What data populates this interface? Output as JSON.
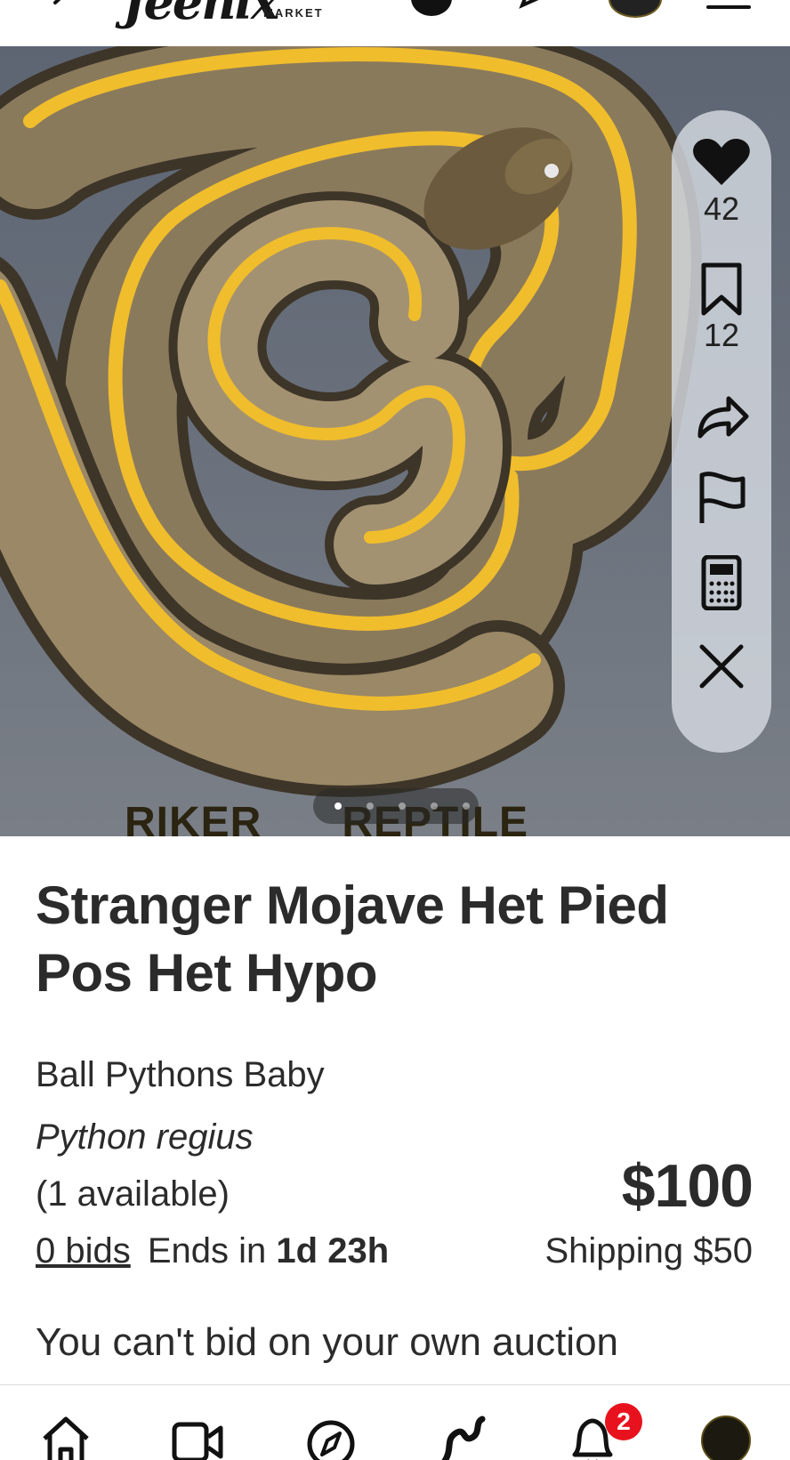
{
  "header": {
    "logo_main": "Jeenix",
    "logo_sub": "MARKET",
    "icons": [
      "back-icon",
      "info-icon",
      "chat-icon",
      "profile-avatar",
      "menu-icon"
    ]
  },
  "gallery": {
    "watermark_left": "RIKER",
    "watermark_right": "REPTILE",
    "image_count": 5,
    "active_index": 0
  },
  "actions": {
    "likes_count": "42",
    "saves_count": "12",
    "icons": [
      "heart-icon",
      "bookmark-icon",
      "share-icon",
      "flag-icon",
      "calculator-icon",
      "close-icon"
    ]
  },
  "listing": {
    "title": "Stranger Mojave Het Pied Pos Het Hypo",
    "category": "Ball Pythons Baby",
    "species": "Python regius",
    "availability": "(1 available)",
    "bids": "0 bids",
    "ends_prefix": "Ends in",
    "ends_value": "1d 23h",
    "price": "$100",
    "shipping": "Shipping $50",
    "notice": "You can't bid on your own auction"
  },
  "bottom_nav": {
    "items": [
      "home-icon",
      "video-icon",
      "compass-icon",
      "snake-icon",
      "bell-icon",
      "profile-avatar"
    ],
    "notification_count": "2"
  },
  "colors": {
    "snake_body": "#8a7a5c",
    "snake_stripe": "#f0bd2c",
    "badge": "#e8121e"
  }
}
